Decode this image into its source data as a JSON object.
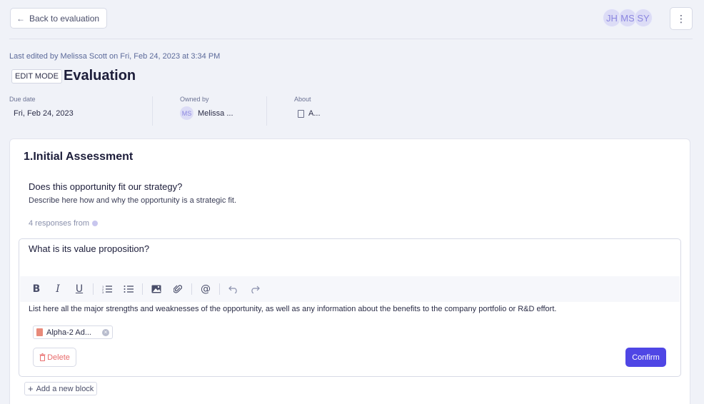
{
  "header": {
    "back_label": "Back to evaluation",
    "avatars": [
      "JH",
      "MS",
      "SY"
    ],
    "more_icon": "⋮"
  },
  "page": {
    "last_edited": "Last edited by Melissa Scott on Fri, Feb 24, 2023 at 3:34 PM",
    "mode": "EDIT MODE",
    "title": "Evaluation"
  },
  "meta": {
    "due_date_label": "Due date",
    "due_date_value": "Fri, Feb 24, 2023",
    "owned_by_label": "Owned by",
    "owner_initials": "MS",
    "owner_name": "Melissa ...",
    "about_label": "About",
    "about_value": "A..."
  },
  "section": {
    "title": "1.Initial Assessment",
    "question1": {
      "title": "Does this opportunity fit our strategy?",
      "description": "Describe here how and why the opportunity is a strategic fit.",
      "responses": "4 responses from"
    },
    "editor": {
      "question_value": "What is its value proposition?",
      "description": "List here all the major strengths and weaknesses of the opportunity, as well as any information about the benefits to the company portfolio or R&D effort.",
      "attachment_name": "Alpha-2 Ad...",
      "delete_label": "Delete",
      "confirm_label": "Confirm"
    },
    "add_block_label": "Add a new block"
  },
  "colors": {
    "accent": "#4f46e5",
    "danger": "#e86a6a",
    "avatar_bg": "#dcdcf6"
  }
}
